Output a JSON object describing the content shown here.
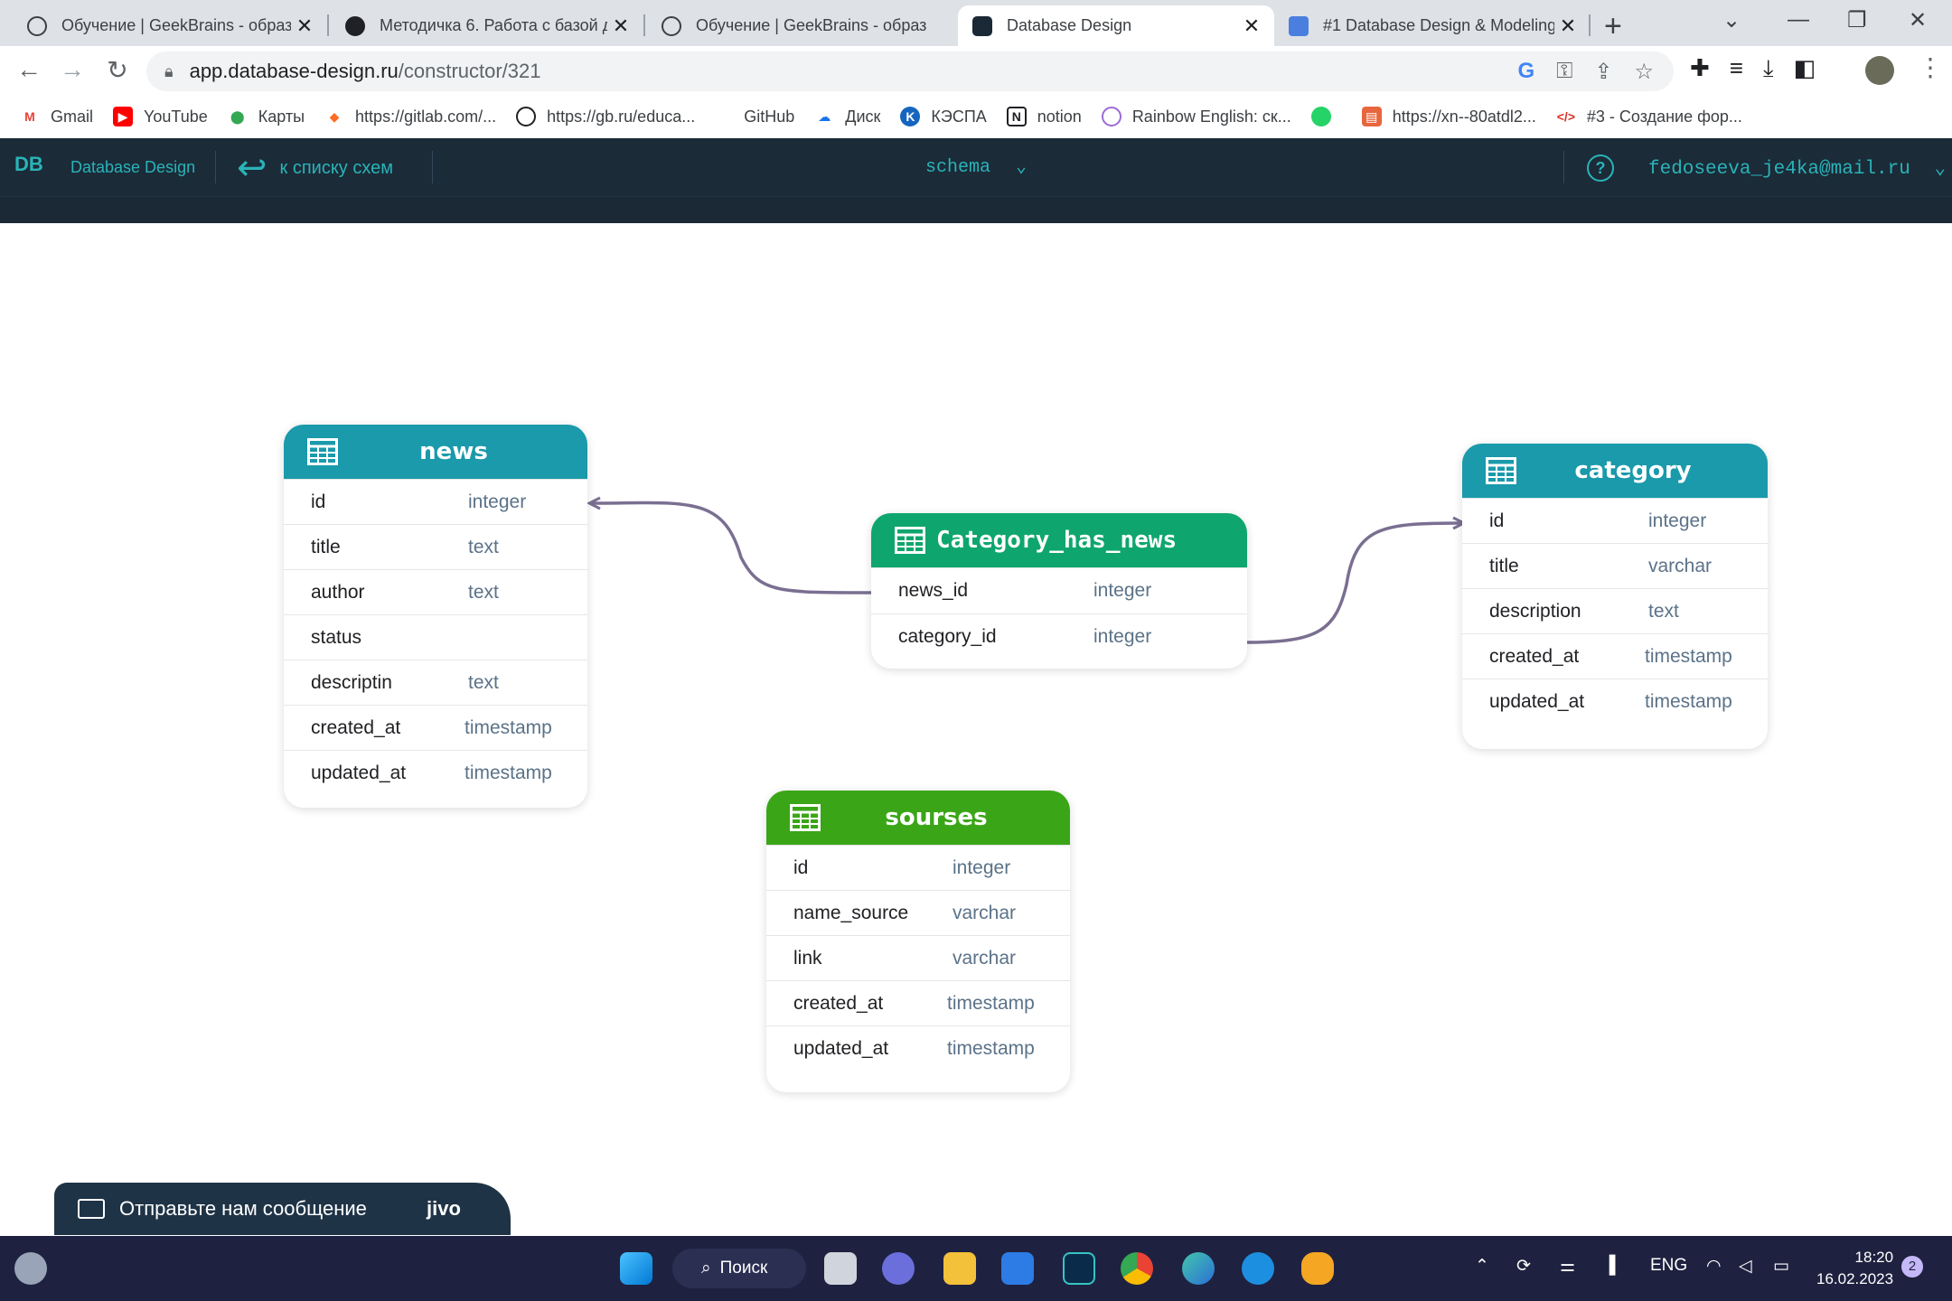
{
  "browser": {
    "tabs": [
      {
        "title": "Обучение | GeekBrains - образ",
        "active": false
      },
      {
        "title": "Методичка 6. Работа с базой д",
        "active": false
      },
      {
        "title": "Обучение | GeekBrains - образ",
        "active": false
      },
      {
        "title": "Database Design",
        "active": true
      },
      {
        "title": "#1 Database Design & Modeling",
        "active": false
      }
    ],
    "close_glyph": "✕",
    "new_tab_glyph": "+",
    "url_host": "app.database-design.ru",
    "url_path": "/constructor/321",
    "bookmarks": [
      {
        "label": "Gmail",
        "color": "#ea4335"
      },
      {
        "label": "YouTube",
        "color": "#ff0000"
      },
      {
        "label": "Карты",
        "color": "#34a853"
      },
      {
        "label": "https://gitlab.com/...",
        "color": "#fc6d26"
      },
      {
        "label": "https://gb.ru/educa...",
        "color": "#202124"
      },
      {
        "label": "GitHub",
        "color": "#ffffff"
      },
      {
        "label": "Диск",
        "color": "#1a73e8"
      },
      {
        "label": "КЭСПА",
        "color": "#1565c0"
      },
      {
        "label": "notion",
        "color": "#202124"
      },
      {
        "label": "Rainbow English: ск...",
        "color": "#9c6bd6"
      },
      {
        "label": "",
        "color": "#25d366"
      },
      {
        "label": "https://xn--80atdl2...",
        "color": "#e8663d"
      },
      {
        "label": "#3 - Создание фор...",
        "color": "#d93025"
      }
    ]
  },
  "app": {
    "logo_mark": "DB",
    "logo_text": "Database  Design",
    "back_label": "к списку схем",
    "schema_label": "schema",
    "help_glyph": "?",
    "user_email": "fedoseeva_je4ka@mail.ru",
    "accent_color": "#2ab3b8",
    "header_bg": "#1b2836"
  },
  "tables": [
    {
      "name": "news",
      "header_color": "#1a9aab",
      "columns": [
        {
          "name": "id",
          "type": "integer"
        },
        {
          "name": "title",
          "type": "text"
        },
        {
          "name": "author",
          "type": "text"
        },
        {
          "name": "status",
          "type": ""
        },
        {
          "name": "descriptin",
          "type": "text"
        },
        {
          "name": "created_at",
          "type": "timestamp"
        },
        {
          "name": "updated_at",
          "type": "timestamp"
        }
      ]
    },
    {
      "name": "Category_has_news",
      "header_color": "#0ea66e",
      "columns": [
        {
          "name": "news_id",
          "type": "integer"
        },
        {
          "name": "category_id",
          "type": "integer"
        }
      ]
    },
    {
      "name": "category",
      "header_color": "#1a9aab",
      "columns": [
        {
          "name": "id",
          "type": "integer"
        },
        {
          "name": "title",
          "type": "varchar"
        },
        {
          "name": "description",
          "type": "text"
        },
        {
          "name": "created_at",
          "type": "timestamp"
        },
        {
          "name": "updated_at",
          "type": "timestamp"
        }
      ]
    },
    {
      "name": "sourses",
      "header_color": "#3aa617",
      "columns": [
        {
          "name": "id",
          "type": "integer"
        },
        {
          "name": "name_source",
          "type": "varchar"
        },
        {
          "name": "link",
          "type": "varchar"
        },
        {
          "name": "created_at",
          "type": "timestamp"
        },
        {
          "name": "updated_at",
          "type": "timestamp"
        }
      ]
    }
  ],
  "relations": [
    {
      "from": "Category_has_news.news_id",
      "to": "news.id"
    },
    {
      "from": "Category_has_news.category_id",
      "to": "category.id"
    }
  ],
  "chat_widget": {
    "label": "Отправьте нам сообщение",
    "brand": "jivo"
  },
  "taskbar": {
    "search_label": "Поиск",
    "language": "ENG",
    "time": "18:20",
    "date": "16.02.2023",
    "notification_count": "2"
  }
}
